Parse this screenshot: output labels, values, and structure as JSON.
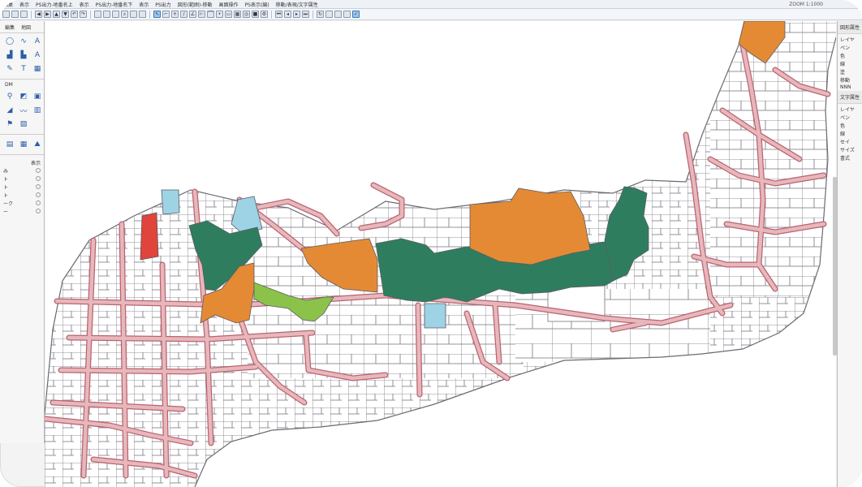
{
  "menu": {
    "items": [
      "編集",
      "表示",
      "PS出力-地番名上",
      "表示",
      "PS出力-地番名下",
      "表示",
      "PS出力",
      "図形(範囲)-移動",
      "画面操作",
      "PS表示(編)",
      "移動/表現/文字属性"
    ],
    "right_status": "ZOOM 1:1000"
  },
  "left_panel": {
    "tabs": [
      "編集",
      "地図"
    ],
    "section_label": "DM",
    "tool_icons": [
      "line-icon",
      "curve-icon",
      "text-icon",
      "chart-icon",
      "stairs-icon",
      "text-a-icon",
      "edit-icon",
      "text-tool-icon",
      "grid-icon"
    ],
    "tool_icons_2": [
      "pin-icon",
      "layers-icon",
      "window-icon",
      "measure-icon",
      "wave-icon",
      "bars-icon",
      "flag-icon",
      "image-icon"
    ],
    "tool_icons_3": [
      "grid2-icon",
      "table-icon",
      "mountain-icon"
    ],
    "layers_header": "表示",
    "layers": [
      "み",
      "ト",
      "ト",
      "ト",
      "ーク",
      "ー"
    ]
  },
  "right_panel": {
    "section1": "図形属性",
    "rows1": [
      "レイヤ",
      "ペン",
      "色",
      "線",
      "塗",
      "移動",
      "NNN"
    ],
    "section2": "文字属性",
    "rows2": [
      "レイヤ",
      "ペン",
      "色",
      "線",
      "セイ",
      "サイズ",
      "書式"
    ]
  },
  "colors": {
    "road": "#d9a1a8",
    "road_edge": "#b8646f",
    "parcel_line": "#6d6d78",
    "orange": "#e48a35",
    "green": "#2f7d5f",
    "lightgreen": "#8bc34a",
    "blue": "#9ed3e6",
    "red": "#e0443a"
  }
}
